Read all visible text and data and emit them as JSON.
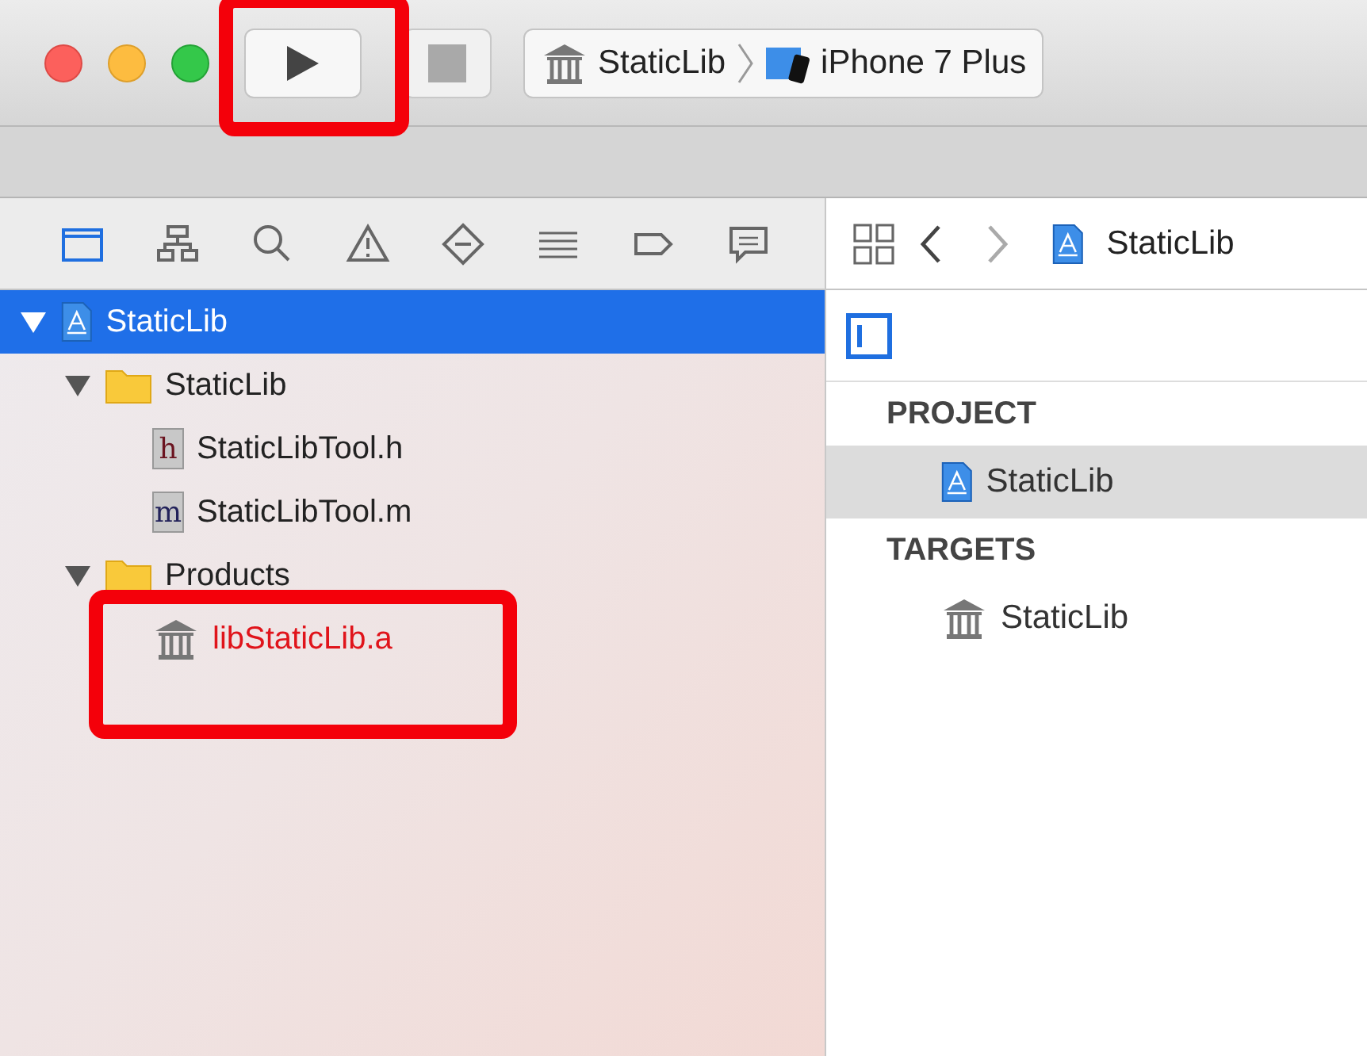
{
  "toolbar": {
    "run_button": {
      "highlighted": true
    },
    "stop_button": {
      "disabled": true
    },
    "scheme": {
      "target": "StaticLib",
      "device": "iPhone 7 Plus"
    }
  },
  "navigator_tabs": [
    {
      "kind": "folder",
      "selected": true
    },
    {
      "kind": "hierarchy",
      "selected": false
    },
    {
      "kind": "search",
      "selected": false
    },
    {
      "kind": "warning",
      "selected": false
    },
    {
      "kind": "breakpoint",
      "selected": false
    },
    {
      "kind": "list",
      "selected": false
    },
    {
      "kind": "tag",
      "selected": false
    },
    {
      "kind": "comment",
      "selected": false
    }
  ],
  "tree": [
    {
      "kind": "project",
      "label": "StaticLib",
      "expanded": true,
      "selected": true,
      "children": [
        {
          "kind": "folder",
          "label": "StaticLib",
          "expanded": true,
          "selected": false,
          "children": [
            {
              "kind": "file",
              "letter": "h",
              "label": "StaticLibTool.h",
              "selected": false
            },
            {
              "kind": "file",
              "letter": "m",
              "label": "StaticLibTool.m",
              "selected": false
            }
          ]
        },
        {
          "kind": "folder",
          "label": "Products",
          "expanded": true,
          "selected": false,
          "children": [
            {
              "kind": "library",
              "label": "libStaticLib.a",
              "missing": true,
              "highlighted": true,
              "selected": false
            }
          ]
        }
      ]
    }
  ],
  "editor": {
    "jump_bar": {
      "file": "StaticLib"
    },
    "sections": [
      {
        "title": "PROJECT",
        "items": [
          {
            "kind": "project",
            "label": "StaticLib",
            "selected": true
          }
        ]
      },
      {
        "title": "TARGETS",
        "items": [
          {
            "kind": "library",
            "label": "StaticLib",
            "selected": false
          }
        ]
      }
    ]
  }
}
